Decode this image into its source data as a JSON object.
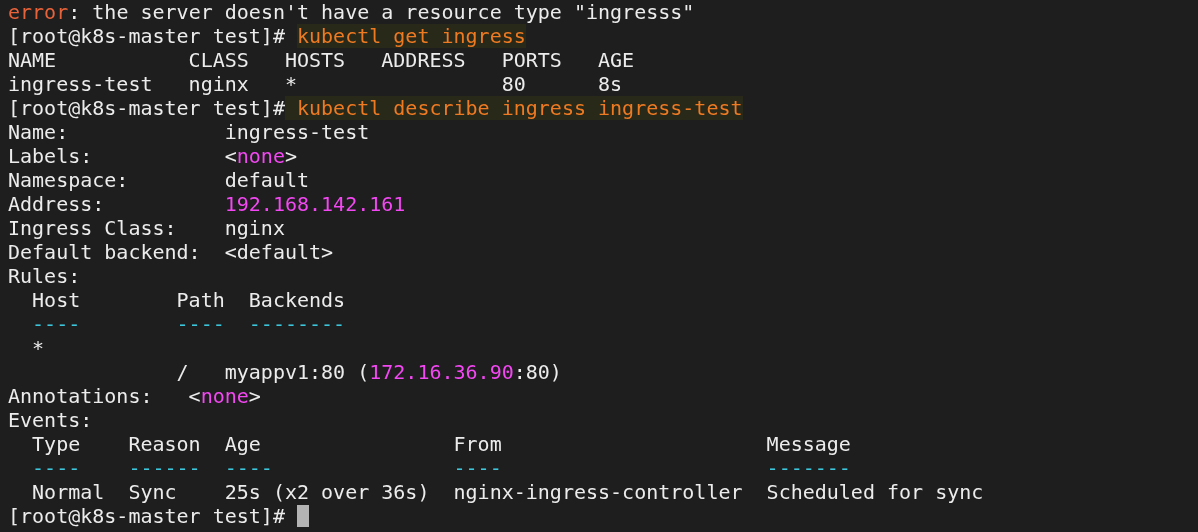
{
  "terminal": {
    "lines": [
      {
        "segments": [
          {
            "kind": "error",
            "text": "error"
          },
          {
            "kind": "plain",
            "text": ": the server doesn't have a resource type \"ingresss\""
          }
        ]
      },
      {
        "segments": [
          {
            "kind": "prompt",
            "text": "[root@k8s-master test]# "
          },
          {
            "kind": "command",
            "text": "kubectl get ingress"
          }
        ]
      },
      {
        "segments": [
          {
            "kind": "plain",
            "text": "NAME           CLASS   HOSTS   ADDRESS   PORTS   AGE"
          }
        ]
      },
      {
        "segments": [
          {
            "kind": "plain",
            "text": "ingress-test   nginx   *                 80      8s"
          }
        ]
      },
      {
        "segments": [
          {
            "kind": "prompt",
            "text": "[root@k8s-master test]#"
          },
          {
            "kind": "command",
            "text": " kubectl describe ingress ingress-test"
          }
        ]
      },
      {
        "segments": [
          {
            "kind": "plain",
            "text": "Name:             ingress-test"
          }
        ]
      },
      {
        "segments": [
          {
            "kind": "plain",
            "text": "Labels:           <"
          },
          {
            "kind": "value",
            "text": "none"
          },
          {
            "kind": "plain",
            "text": ">"
          }
        ]
      },
      {
        "segments": [
          {
            "kind": "plain",
            "text": "Namespace:        default"
          }
        ]
      },
      {
        "segments": [
          {
            "kind": "plain",
            "text": "Address:          "
          },
          {
            "kind": "value",
            "text": "192.168.142.161"
          }
        ]
      },
      {
        "segments": [
          {
            "kind": "plain",
            "text": "Ingress Class:    nginx"
          }
        ]
      },
      {
        "segments": [
          {
            "kind": "plain",
            "text": "Default backend:  <default>"
          }
        ]
      },
      {
        "segments": [
          {
            "kind": "plain",
            "text": "Rules:"
          }
        ]
      },
      {
        "segments": [
          {
            "kind": "plain",
            "text": "  Host        Path  Backends"
          }
        ]
      },
      {
        "segments": [
          {
            "kind": "rule",
            "text": "  ----        ----  --------"
          }
        ]
      },
      {
        "segments": [
          {
            "kind": "plain",
            "text": "  *"
          }
        ]
      },
      {
        "segments": [
          {
            "kind": "plain",
            "text": "              /   myappv1:80 ("
          },
          {
            "kind": "value",
            "text": "172.16.36.90"
          },
          {
            "kind": "plain",
            "text": ":80)"
          }
        ]
      },
      {
        "segments": [
          {
            "kind": "plain",
            "text": "Annotations:   <"
          },
          {
            "kind": "value",
            "text": "none"
          },
          {
            "kind": "plain",
            "text": ">"
          }
        ]
      },
      {
        "segments": [
          {
            "kind": "plain",
            "text": "Events:"
          }
        ]
      },
      {
        "segments": [
          {
            "kind": "plain",
            "text": "  Type    Reason  Age                From                      Message"
          }
        ]
      },
      {
        "segments": [
          {
            "kind": "rule",
            "text": "  ----    ------  ----               ----                      -------"
          }
        ]
      },
      {
        "segments": [
          {
            "kind": "plain",
            "text": "  Normal  Sync    25s (x2 over 36s)  nginx-ingress-controller  Scheduled for sync"
          }
        ]
      },
      {
        "segments": [
          {
            "kind": "prompt",
            "text": "[root@k8s-master test]# "
          }
        ],
        "cursor": true
      }
    ]
  }
}
